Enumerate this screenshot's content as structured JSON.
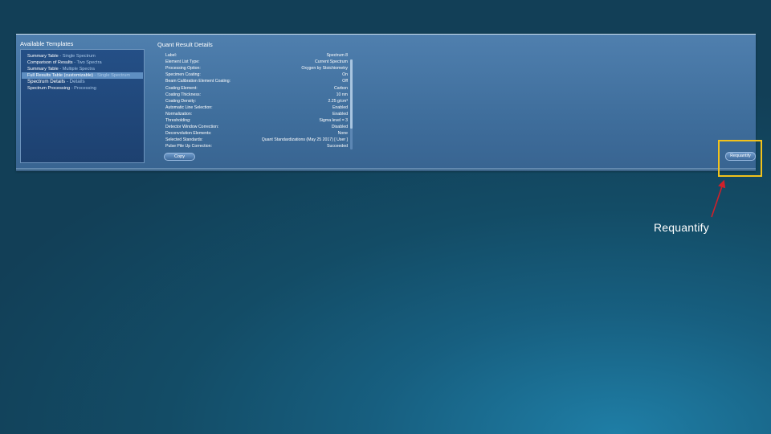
{
  "templates": {
    "title": "Available Templates",
    "items": [
      {
        "label": "Summary Table",
        "sub": "- Single Spectrum",
        "selected": false,
        "group": false
      },
      {
        "label": "Comparison of Results",
        "sub": "- Two Spectra",
        "selected": false,
        "group": false
      },
      {
        "label": "Summary Table",
        "sub": "- Multiple Spectra",
        "selected": false,
        "group": false
      },
      {
        "label": "Full Results Table (customizable)",
        "sub": "- Single Spectrum",
        "selected": true,
        "group": false
      },
      {
        "label": "Spectrum Details",
        "sub": "- Details",
        "selected": false,
        "group": true
      },
      {
        "label": "Spectrum Processing",
        "sub": "- Processing",
        "selected": false,
        "group": false
      }
    ]
  },
  "details": {
    "title": "Quant Result Details",
    "rows": [
      {
        "key": "Label:",
        "value": "Spectrum 8"
      },
      {
        "key": "Element List Type:",
        "value": "Current Spectrum"
      },
      {
        "key": "Processing Option:",
        "value": "Oxygen by Stoichiometry"
      },
      {
        "key": "Specimen Coating:",
        "value": "On"
      },
      {
        "key": "Beam Calibration Element Coating:",
        "value": "Off"
      },
      {
        "key": "Coating Element:",
        "value": "Carbon"
      },
      {
        "key": "Coating Thickness:",
        "value": "10 nm"
      },
      {
        "key": "Coating Density:",
        "value": "2.25 g/cm³"
      },
      {
        "key": "Automatic Line Selection:",
        "value": "Enabled"
      },
      {
        "key": "Normalization:",
        "value": "Enabled"
      },
      {
        "key": "Thresholding:",
        "value": "Sigma level = 3"
      },
      {
        "key": "Detector Window Correction:",
        "value": "Disabled"
      },
      {
        "key": "Deconvolution Elements:",
        "value": "None"
      },
      {
        "key": "Selected Standards:",
        "value": "Quant Standardizations (May 25 2017) [ User ]"
      },
      {
        "key": "Pulse Pile Up Correction:",
        "value": "Succeeded"
      }
    ]
  },
  "buttons": {
    "copy": "Copy",
    "requantify": "Requantify"
  },
  "annotation": {
    "label": "Requantify",
    "highlight_color": "#f2c21b",
    "arrow_color": "#d0202a"
  }
}
